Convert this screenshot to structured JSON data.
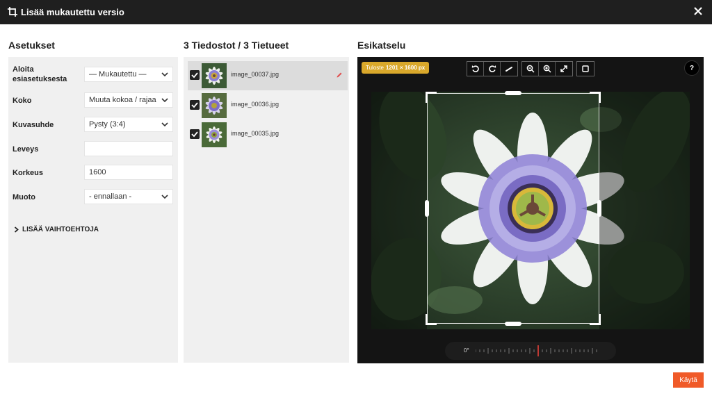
{
  "window": {
    "title": "Lisää mukautettu versio"
  },
  "settings": {
    "heading": "Asetukset",
    "rows": [
      {
        "label": "Aloita esiasetuksesta",
        "value": "— Mukautettu —",
        "type": "select"
      },
      {
        "label": "Koko",
        "value": "Muuta kokoa / rajaa",
        "type": "select"
      },
      {
        "label": "Kuvasuhde",
        "value": "Pysty (3:4)",
        "type": "select"
      },
      {
        "label": "Leveys",
        "value": "",
        "type": "input"
      },
      {
        "label": "Korkeus",
        "value": "1600",
        "type": "input"
      },
      {
        "label": "Muoto",
        "value": "- ennallaan -",
        "type": "select"
      }
    ],
    "more_options": "LISÄÄ VAIHTOEHTOJA"
  },
  "files": {
    "heading": "3 Tiedostot / 3 Tietueet",
    "items": [
      {
        "name": "image_00037.jpg",
        "checked": true,
        "selected": true
      },
      {
        "name": "image_00036.jpg",
        "checked": true,
        "selected": false
      },
      {
        "name": "image_00035.jpg",
        "checked": true,
        "selected": false
      }
    ]
  },
  "preview": {
    "heading": "Esikatselu",
    "output_label": "Tuloste",
    "output_size": "1201 × 1600 px",
    "rotation": "0°",
    "help": "?"
  },
  "footer": {
    "apply_label": "Käytä"
  },
  "colors": {
    "accent": "#f05a28",
    "badge": "#d9a82b",
    "titlebar": "#1f1f1f",
    "dial_marker": "#e8413a"
  }
}
